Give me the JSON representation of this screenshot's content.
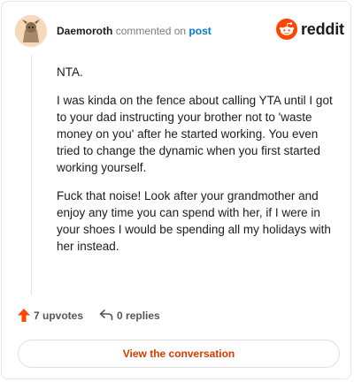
{
  "header": {
    "username": "Daemoroth",
    "commented_text": "commented on",
    "post_link": "post",
    "logo_text": "reddit"
  },
  "comment": {
    "paragraphs": [
      "NTA.",
      "I was kinda on the fence about calling YTA until I got to your dad instructing your brother not to 'waste money on you' after he started working. You even tried to change the dynamic when you first started working yourself.",
      "Fuck that noise! Look after your grandmother and enjoy any time you can spend with her, if I were in your shoes I would be spending all my holidays with her instead."
    ]
  },
  "actions": {
    "upvotes": "7 upvotes",
    "replies": "0 replies"
  },
  "view_button": "View the conversation",
  "colors": {
    "accent": "#ff4500",
    "button_text": "#d93a00",
    "link": "#0079d3"
  }
}
